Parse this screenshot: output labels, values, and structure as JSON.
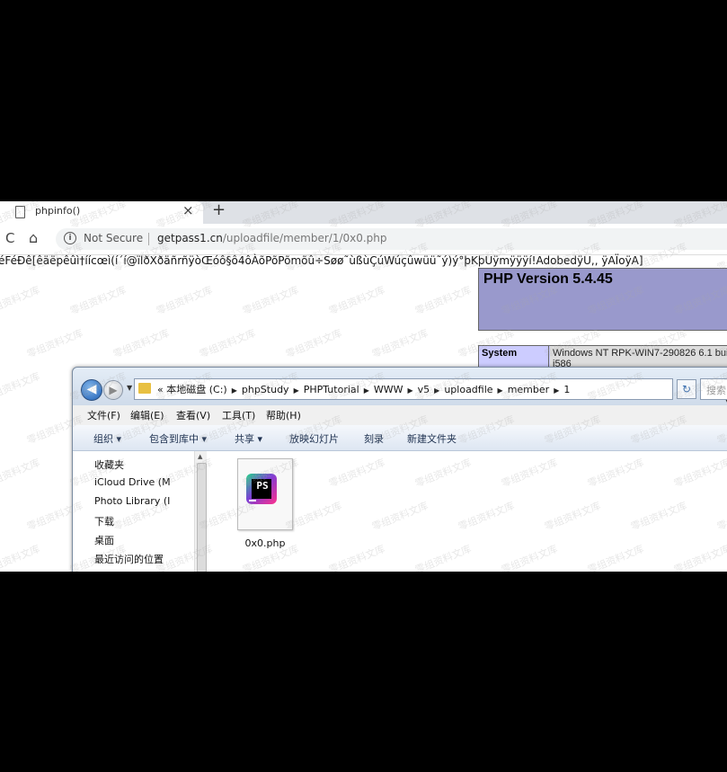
{
  "browser": {
    "tab_title": "phpinfo()",
    "tab_close": "×",
    "new_tab": "+",
    "reload_glyph": "C",
    "home_glyph": "⌂",
    "info_glyph": "i",
    "security_text": "Not Secure",
    "url_host": "getpass1.cn",
    "url_path": "/uploadfile/member/1/0x0.php"
  },
  "page": {
    "garbled_text": "éFéÐê[êäëpêûì†íícœì(í´í@ïlðXðäñrñÿòŒóô§ô4ôÀõPõPõmõû÷Søø˜ùßùÇúWúçûwüü˜ý)ý°þKþUÿmÿÿÿí!AdobedÿU,,      ÿAÏoÿA]",
    "php_version": "PHP Version 5.4.45",
    "system_label": "System",
    "system_value": "Windows NT RPK-WIN7-290826 6.1 bui",
    "system_value_2": "i586"
  },
  "explorer": {
    "back_glyph": "◀",
    "forward_glyph": "▶",
    "breadcrumbs": [
      "«",
      "本地磁盘 (C:)",
      "phpStudy",
      "PHPTutorial",
      "WWW",
      "v5",
      "uploadfile",
      "member",
      "1"
    ],
    "search_placeholder": "搜索",
    "refresh_glyph": "↻",
    "menu": [
      "文件(F)",
      "编辑(E)",
      "查看(V)",
      "工具(T)",
      "帮助(H)"
    ],
    "commands": [
      "组织 ▾",
      "包含到库中 ▾",
      "共享 ▾",
      "放映幻灯片",
      "刻录",
      "新建文件夹"
    ],
    "nav": [
      "收藏夹",
      "iCloud Drive (M",
      "Photo Library (I",
      "下载",
      "桌面",
      "最近访问的位置"
    ],
    "file_name": "0x0.php",
    "file_icon_text": "PS"
  },
  "watermark": "零组资料文库",
  "colors": {
    "php_header": "#9999cc",
    "php_key": "#ccccff",
    "explorer_frame": "#dfe8f2"
  }
}
